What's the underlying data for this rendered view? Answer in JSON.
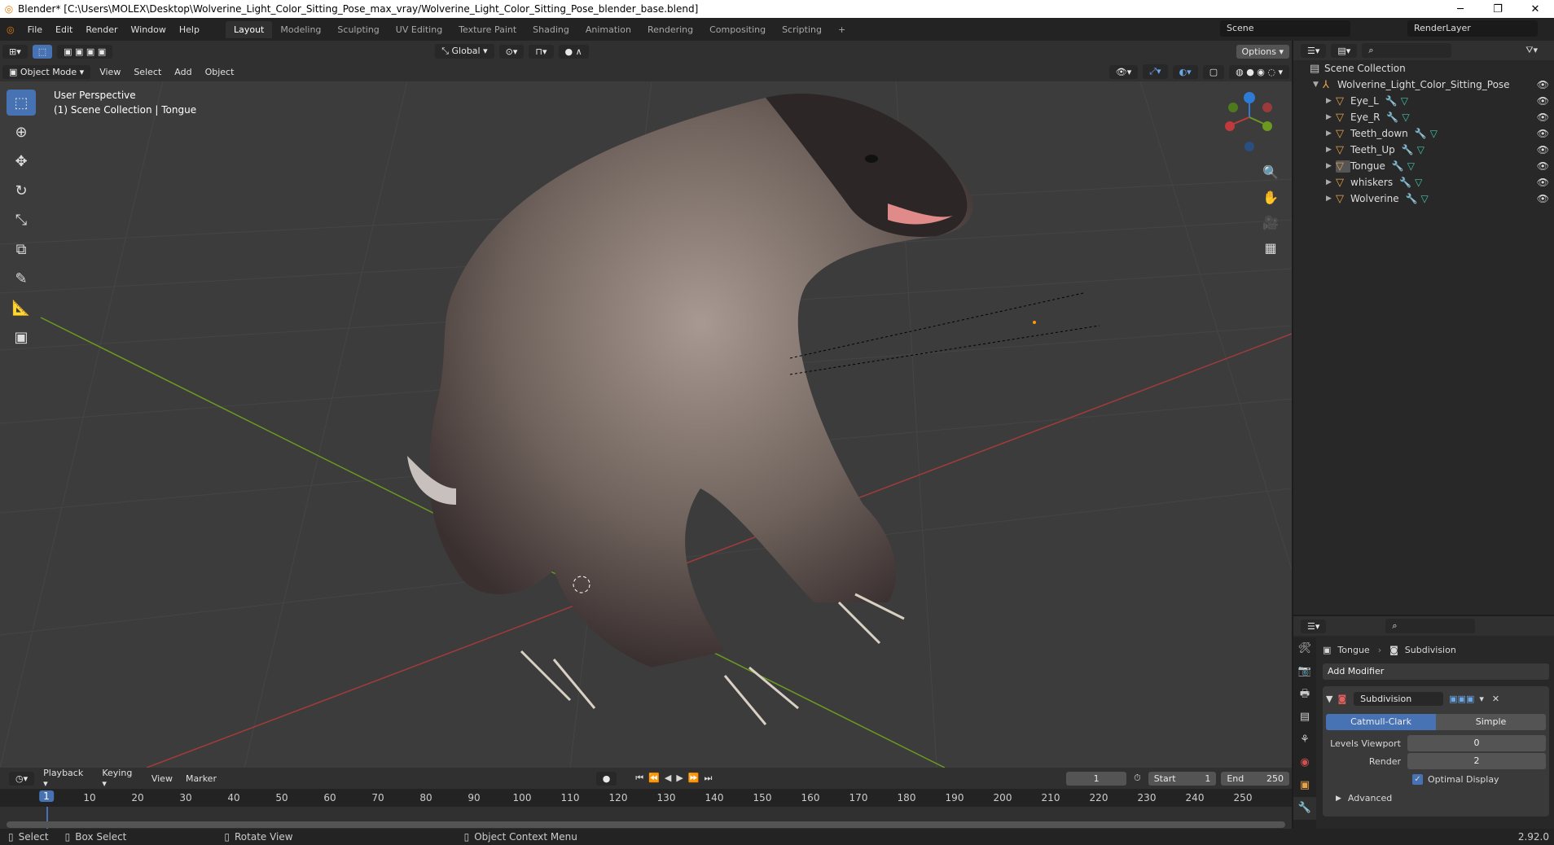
{
  "window": {
    "title": "Blender* [C:\\Users\\MOLEX\\Desktop\\Wolverine_Light_Color_Sitting_Pose_max_vray/Wolverine_Light_Color_Sitting_Pose_blender_base.blend]"
  },
  "menu": [
    "File",
    "Edit",
    "Render",
    "Window",
    "Help"
  ],
  "workspaces": [
    "Layout",
    "Modeling",
    "Sculpting",
    "UV Editing",
    "Texture Paint",
    "Shading",
    "Animation",
    "Rendering",
    "Compositing",
    "Scripting"
  ],
  "active_workspace": "Layout",
  "scene": "Scene",
  "render_layer": "RenderLayer",
  "viewport": {
    "transform_orientation": "Global",
    "options_label": "Options",
    "mode": "Object Mode",
    "menus": [
      "View",
      "Select",
      "Add",
      "Object"
    ],
    "info_line1": "User Perspective",
    "info_line2": "(1) Scene Collection | Tongue"
  },
  "outliner": {
    "root": "Scene Collection",
    "collection": "Wolverine_Light_Color_Sitting_Pose",
    "items": [
      "Eye_L",
      "Eye_R",
      "Teeth_down",
      "Teeth_Up",
      "Tongue",
      "whiskers",
      "Wolverine"
    ],
    "selected": "Tongue"
  },
  "properties": {
    "object": "Tongue",
    "modifier_context": "Subdivision",
    "add_modifier": "Add Modifier",
    "modifier_name": "Subdivision",
    "type_options": [
      "Catmull-Clark",
      "Simple"
    ],
    "selected_type": "Catmull-Clark",
    "levels_viewport_label": "Levels Viewport",
    "levels_viewport": "0",
    "render_label": "Render",
    "render": "2",
    "optimal_display": "Optimal Display",
    "advanced": "Advanced"
  },
  "timeline": {
    "menus": [
      "Playback",
      "Keying",
      "View",
      "Marker"
    ],
    "current_frame": "1",
    "start_label": "Start",
    "start": "1",
    "end_label": "End",
    "end": "250",
    "ticks": [
      "1",
      "10",
      "20",
      "30",
      "40",
      "50",
      "60",
      "70",
      "80",
      "90",
      "100",
      "110",
      "120",
      "130",
      "140",
      "150",
      "160",
      "170",
      "180",
      "190",
      "200",
      "210",
      "220",
      "230",
      "240",
      "250"
    ]
  },
  "status": {
    "select": "Select",
    "box_select": "Box Select",
    "rotate_view": "Rotate View",
    "context_menu": "Object Context Menu",
    "version": "2.92.0"
  },
  "colors": {
    "accent": "#4772b3",
    "x_axis": "#c0393b",
    "y_axis": "#6b9a1f",
    "z_axis": "#2e7bd6"
  }
}
